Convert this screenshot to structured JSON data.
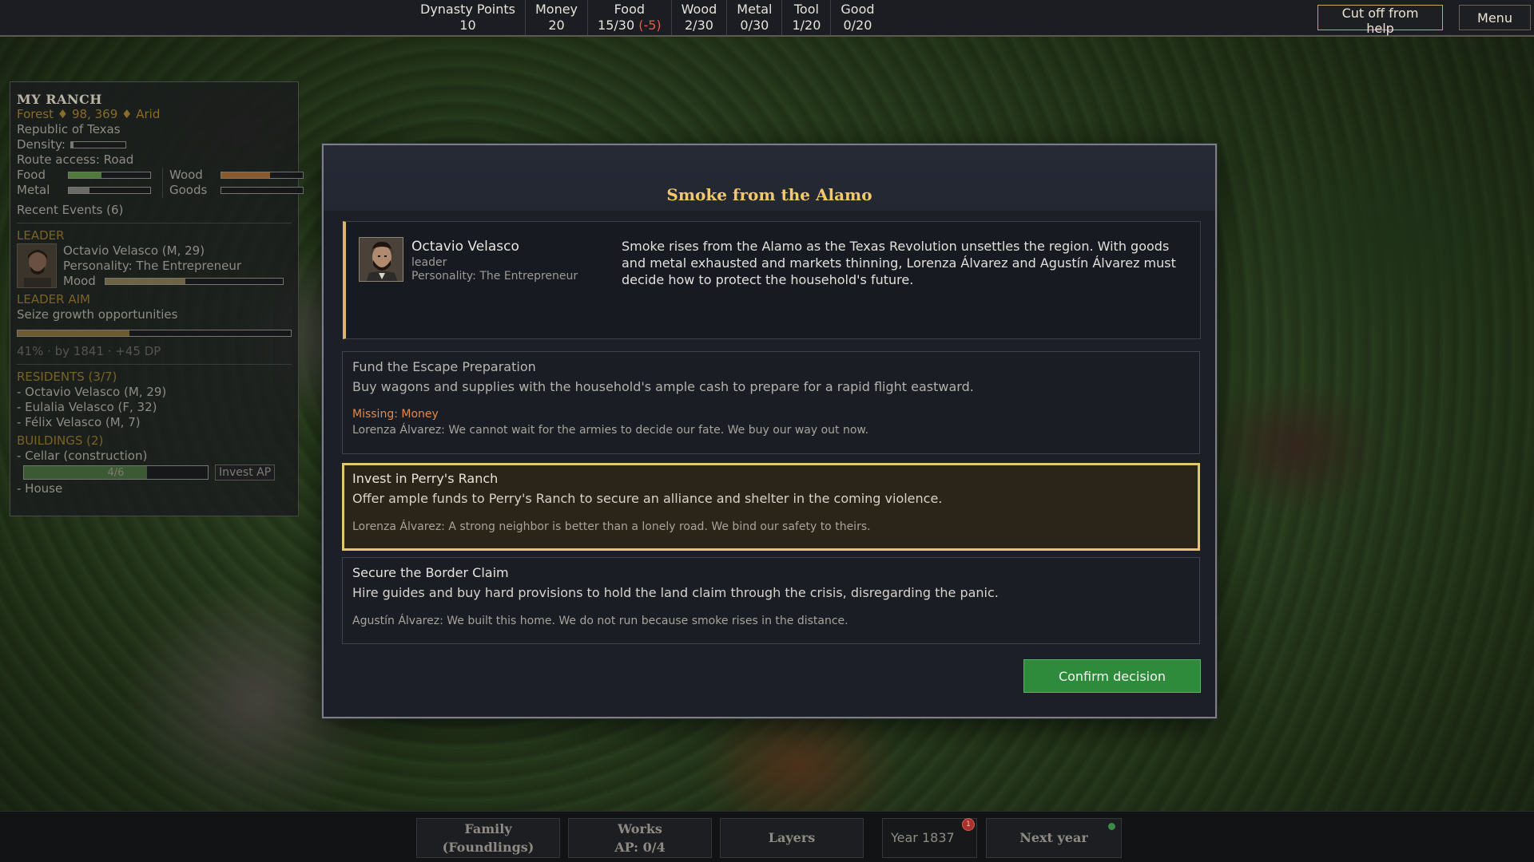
{
  "topbar": {
    "resources": [
      {
        "name": "Dynasty Points",
        "value": "10",
        "delta": ""
      },
      {
        "name": "Money",
        "value": "20",
        "delta": ""
      },
      {
        "name": "Food",
        "value": "15/30",
        "delta": "(-5)"
      },
      {
        "name": "Wood",
        "value": "2/30",
        "delta": ""
      },
      {
        "name": "Metal",
        "value": "0/30",
        "delta": ""
      },
      {
        "name": "Tool",
        "value": "1/20",
        "delta": ""
      },
      {
        "name": "Good",
        "value": "0/20",
        "delta": ""
      }
    ],
    "cutoff_label": "Cut off from help",
    "menu_label": "Menu"
  },
  "ranch": {
    "title": "MY RANCH",
    "location": "Forest ♦ 98, 369 ♦ Arid",
    "nation": "Republic of Texas",
    "density_label": "Density:",
    "density_level": 0.05,
    "route": "Route access: Road",
    "stocks": [
      {
        "label": "Food",
        "level": 0.4,
        "color": "#4f7a3a"
      },
      {
        "label": "Wood",
        "level": 0.6,
        "color": "#8a5a2a"
      },
      {
        "label": "Metal",
        "level": 0.25,
        "color": "#6b6a66"
      },
      {
        "label": "Goods",
        "level": 0.0,
        "color": "#6b6a66"
      }
    ],
    "recent_events": "Recent Events (6)",
    "leader_header": "LEADER",
    "leader_name": "Octavio Velasco (M, 29)",
    "leader_personality": "Personality: The Entrepreneur",
    "mood_label": "Mood",
    "mood_level": 0.45,
    "aim_header": "LEADER AIM",
    "aim_text": "Seize growth opportunities",
    "aim_progress": 0.41,
    "aim_detail": "41% · by 1841 · +45 DP",
    "residents_header": "RESIDENTS (3/7)",
    "residents": [
      "- Octavio Velasco (M, 29)",
      "- Eulalia Velasco (F, 32)",
      "- Félix Velasco (M, 7)"
    ],
    "buildings_header": "BUILDINGS (2)",
    "building_1": "- Cellar (construction)",
    "building_1_progress_text": "4/6",
    "building_1_progress": 0.67,
    "invest_ap_label": "Invest AP",
    "building_2": "- House"
  },
  "event": {
    "title": "Smoke from the Alamo",
    "character": {
      "name": "Octavio Velasco",
      "role": "leader",
      "personality": "Personality: The Entrepreneur"
    },
    "narrative": "Smoke rises from the Alamo as the Texas Revolution unsettles the region. With goods and metal exhausted and markets thinning, Lorenza Álvarez and Agustín Álvarez must decide how to protect the household's future.",
    "choices": [
      {
        "title": "Fund the Escape Preparation",
        "description": "Buy wagons and supplies with the household's ample cash to prepare for a rapid flight eastward.",
        "missing": "Missing: Money",
        "quote": "Lorenza Álvarez: We cannot wait for the armies to decide our fate. We buy our way out now."
      },
      {
        "title": "Invest in Perry's Ranch",
        "description": "Offer ample funds to Perry's Ranch to secure an alliance and shelter in the coming violence.",
        "quote": "Lorenza Álvarez: A strong neighbor is better than a lonely road. We bind our safety to theirs."
      },
      {
        "title": "Secure the Border Claim",
        "description": "Hire guides and buy hard provisions to hold the land claim through the crisis, disregarding the panic.",
        "quote": "Agustín Álvarez: We built this home. We do not run because smoke rises in the distance."
      }
    ],
    "confirm_label": "Confirm decision"
  },
  "bottombar": {
    "family_label": "Family",
    "family_sub": "(Foundlings)",
    "works_label": "Works",
    "works_sub": "AP: 0/4",
    "layers_label": "Layers",
    "year_label": "Year 1837",
    "year_badge": "1",
    "next_year_label": "Next year"
  }
}
